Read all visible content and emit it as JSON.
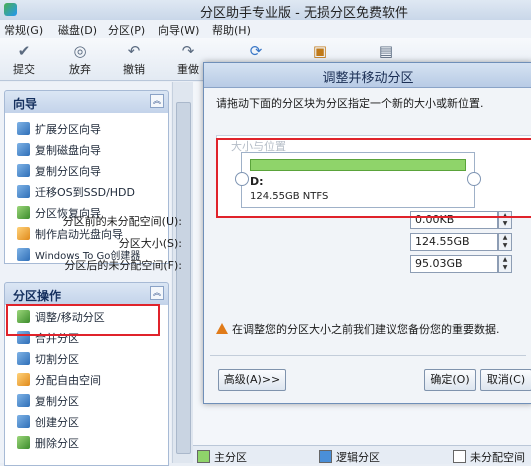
{
  "app": {
    "title": "分区助手专业版 - 无损分区免费软件"
  },
  "menu": [
    "常规(G)",
    "磁盘(D)",
    "分区(P)",
    "向导(W)",
    "帮助(H)"
  ],
  "toolbar": {
    "commit": "提交",
    "discard": "放弃",
    "undo": "撤销",
    "redo": "重做"
  },
  "wizard": {
    "title": "向导",
    "items": [
      "扩展分区向导",
      "复制磁盘向导",
      "复制分区向导",
      "迁移OS到SSD/HDD",
      "分区恢复向导",
      "制作启动光盘向导",
      "Windows To Go创建器"
    ]
  },
  "partition_ops": {
    "title": "分区操作",
    "items": [
      "调整/移动分区",
      "合并分区",
      "切割分区",
      "分配自由空间",
      "复制分区",
      "创建分区",
      "删除分区"
    ]
  },
  "dialog": {
    "title": "调整并移动分区",
    "instruction": "请拖动下面的分区块为分区指定一个新的大小或新位置.",
    "size_position_label": "大小与位置",
    "partition": {
      "drive": "D:",
      "info": "124.55GB NTFS"
    },
    "fields": [
      {
        "label": "分区前的未分配空间(U):",
        "value": "0.00KB"
      },
      {
        "label": "分区大小(S):",
        "value": "124.55GB"
      },
      {
        "label": "分区后的未分配空间(F):",
        "value": "95.03GB"
      }
    ],
    "warning": "在调整您的分区大小之前我们建议您备份您的重要数据.",
    "advanced": "高级(A)>>",
    "ok": "确定(O)",
    "cancel": "取消(C)"
  },
  "legend": {
    "primary": "主分区",
    "logical": "逻辑分区",
    "unallocated": "未分配空间"
  },
  "colors": {
    "primary": "#8fd46a",
    "logical": "#4a8fd8",
    "unallocated": "#ffffff",
    "highlight": "#e0232b"
  }
}
